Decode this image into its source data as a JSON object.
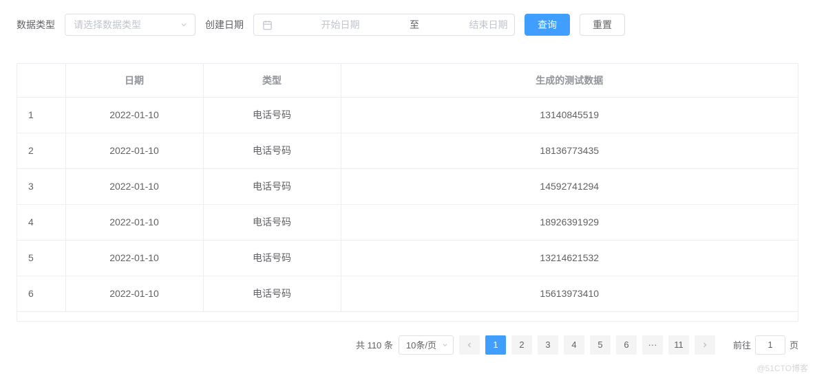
{
  "filters": {
    "data_type_label": "数据类型",
    "data_type_placeholder": "请选择数据类型",
    "create_date_label": "创建日期",
    "start_placeholder": "开始日期",
    "range_separator": "至",
    "end_placeholder": "结束日期",
    "query_label": "查询",
    "reset_label": "重置"
  },
  "table": {
    "headers": {
      "index": "",
      "date": "日期",
      "type": "类型",
      "data": "生成的测试数据"
    },
    "rows": [
      {
        "idx": "1",
        "date": "2022-01-10",
        "type": "电话号码",
        "data": "13140845519"
      },
      {
        "idx": "2",
        "date": "2022-01-10",
        "type": "电话号码",
        "data": "18136773435"
      },
      {
        "idx": "3",
        "date": "2022-01-10",
        "type": "电话号码",
        "data": "14592741294"
      },
      {
        "idx": "4",
        "date": "2022-01-10",
        "type": "电话号码",
        "data": "18926391929"
      },
      {
        "idx": "5",
        "date": "2022-01-10",
        "type": "电话号码",
        "data": "13214621532"
      },
      {
        "idx": "6",
        "date": "2022-01-10",
        "type": "电话号码",
        "data": "15613973410"
      }
    ]
  },
  "pagination": {
    "total_text": "共 110 条",
    "page_size_label": "10条/页",
    "pages": [
      "1",
      "2",
      "3",
      "4",
      "5",
      "6",
      "···",
      "11"
    ],
    "active_page": "1",
    "jump_prefix": "前往",
    "jump_value": "1",
    "jump_suffix": "页"
  },
  "watermark": "@51CTO博客"
}
